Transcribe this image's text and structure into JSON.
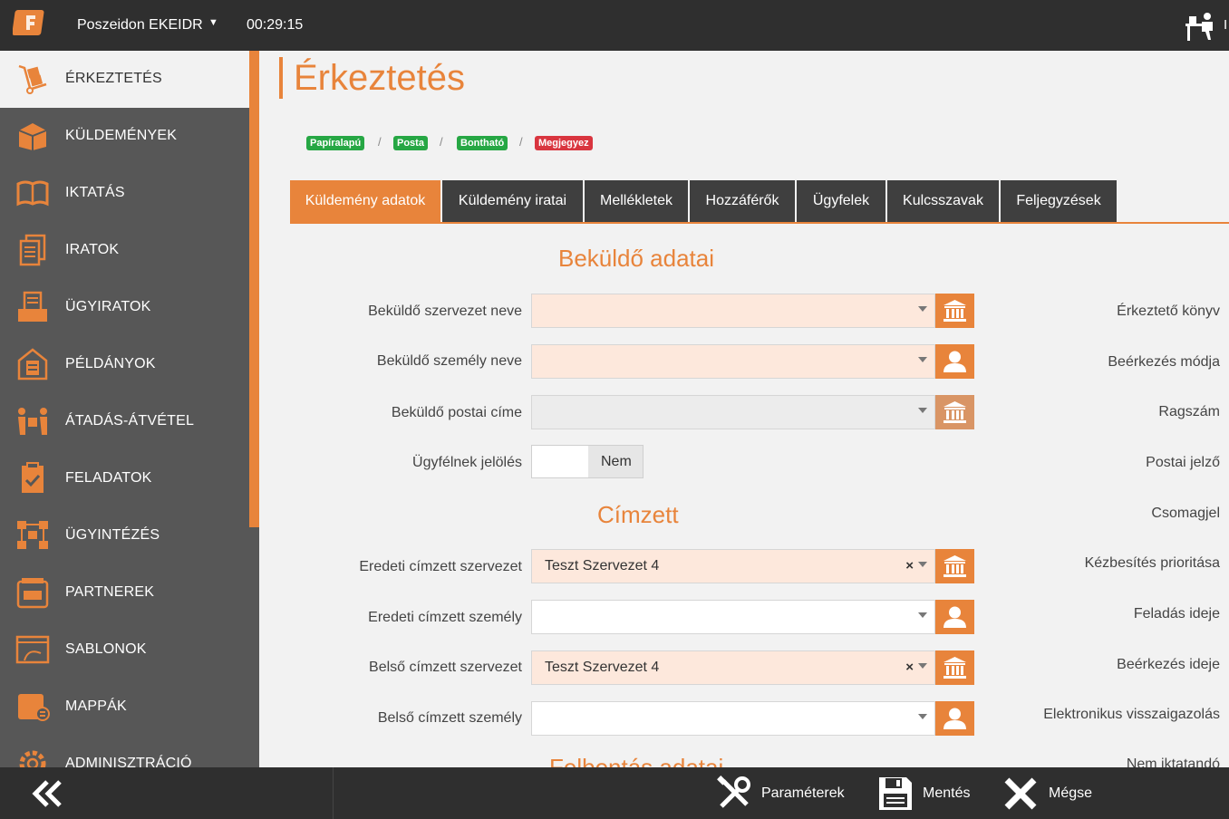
{
  "header": {
    "app_title": "Poszeidon EKEIDR",
    "timer": "00:29:15",
    "user_initial": "I"
  },
  "sidebar": {
    "items": [
      {
        "label": "ÉRKEZTETÉS",
        "icon": "hand-truck-icon",
        "active": true
      },
      {
        "label": "KÜLDEMÉNYEK",
        "icon": "package-icon"
      },
      {
        "label": "IKTATÁS",
        "icon": "book-icon"
      },
      {
        "label": "IRATOK",
        "icon": "documents-icon"
      },
      {
        "label": "ÜGYIRATOK",
        "icon": "file-tray-icon"
      },
      {
        "label": "PÉLDÁNYOK",
        "icon": "copy-house-icon"
      },
      {
        "label": "ÁTADÁS-ÁTVÉTEL",
        "icon": "handover-icon"
      },
      {
        "label": "FELADATOK",
        "icon": "clipboard-check-icon"
      },
      {
        "label": "ÜGYINTÉZÉS",
        "icon": "workflow-icon"
      },
      {
        "label": "PARTNEREK",
        "icon": "partners-icon"
      },
      {
        "label": "SABLONOK",
        "icon": "template-icon"
      },
      {
        "label": "MAPPÁK",
        "icon": "folder-icon"
      },
      {
        "label": "ADMINISZTRÁCIÓ",
        "icon": "gear-icon"
      }
    ]
  },
  "page": {
    "title": "Érkeztetés",
    "badges": [
      {
        "label": "Papíralapú",
        "color": "#26a744"
      },
      {
        "label": "Posta",
        "color": "#26a744"
      },
      {
        "label": "Bontható",
        "color": "#26a744"
      },
      {
        "label": "Megjegyez",
        "color": "#d9353f"
      }
    ],
    "crumb_separator": "/"
  },
  "tabs": [
    {
      "label": "Küldemény adatok",
      "active": true
    },
    {
      "label": "Küldemény iratai"
    },
    {
      "label": "Mellékletek"
    },
    {
      "label": "Hozzáférők"
    },
    {
      "label": "Ügyfelek"
    },
    {
      "label": "Kulcsszavak"
    },
    {
      "label": "Feljegyzések"
    }
  ],
  "sender": {
    "section_title": "Beküldő adatai",
    "org_label": "Beküldő szervezet neve",
    "person_label": "Beküldő személy neve",
    "address_label": "Beküldő postai címe",
    "client_flag_label": "Ügyfélnek jelölés",
    "client_flag_value": "Nem"
  },
  "recipient": {
    "section_title": "Címzett",
    "orig_org_label": "Eredeti címzett szervezet",
    "orig_org_value": "Teszt Szervezet 4",
    "orig_person_label": "Eredeti címzett személy",
    "internal_org_label": "Belső címzett szervezet",
    "internal_org_value": "Teszt Szervezet 4",
    "internal_person_label": "Belső címzett személy",
    "clear_glyph": "×"
  },
  "next_section_title": "Felbontás adatai",
  "right_column": [
    "Érkeztető könyv",
    "Beérkezés módja",
    "Ragszám",
    "Postai jelző",
    "Csomagjel",
    "Kézbesítés prioritása",
    "Feladás ideje",
    "Beérkezés ideje",
    "Elektronikus visszaigazolás",
    "Nem iktatandó"
  ],
  "footer": {
    "parameters_label": "Paraméterek",
    "save_label": "Mentés",
    "cancel_label": "Mégse"
  },
  "colors": {
    "accent": "#e8843b",
    "dark": "#2f2f2f",
    "sidebar": "#575757",
    "field_highlight": "#fde8dc"
  }
}
